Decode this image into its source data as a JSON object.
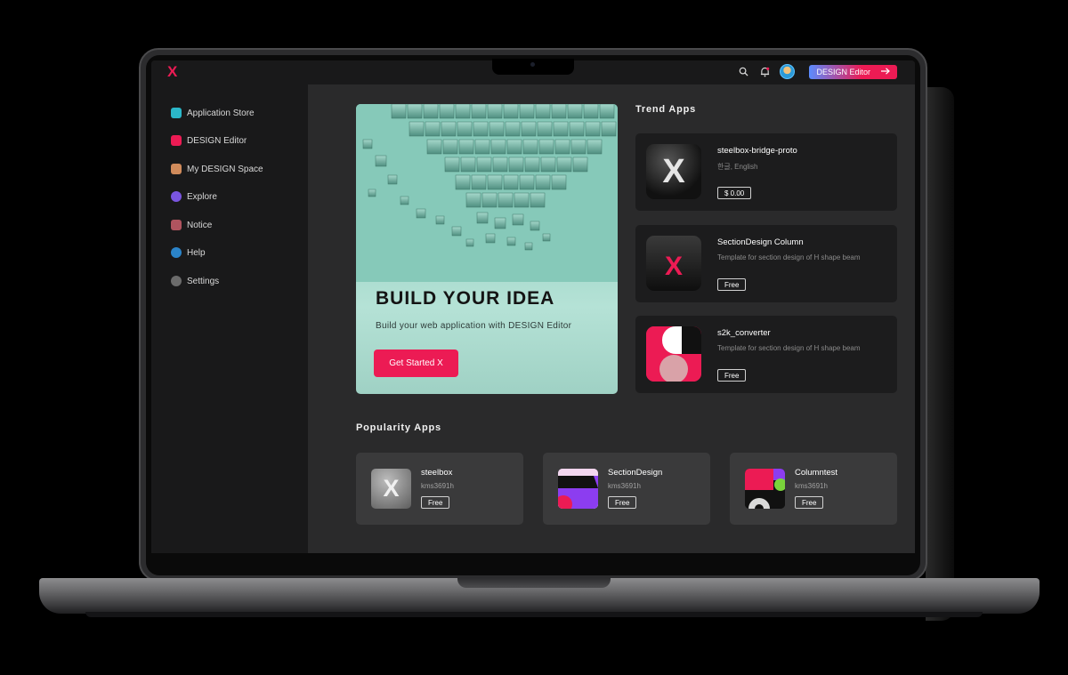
{
  "topbar": {
    "logo": "X",
    "editor_button": "DESIGN Editor",
    "icons": [
      "search-icon",
      "bell-icon",
      "avatar",
      "arrow-right-icon"
    ]
  },
  "sidebar": {
    "items": [
      {
        "label": "Application Store",
        "icon": "store-icon",
        "color": "#2bb7c9"
      },
      {
        "label": "DESIGN Editor",
        "icon": "editor-icon",
        "color": "#ec1b54"
      },
      {
        "label": "My DESIGN Space",
        "icon": "space-icon",
        "color": "#d08b5b"
      },
      {
        "label": "Explore",
        "icon": "compass-icon",
        "color": "#7a55e0"
      },
      {
        "label": "Notice",
        "icon": "notice-icon",
        "color": "#b0545f"
      },
      {
        "label": "Help",
        "icon": "help-icon",
        "color": "#2b84c9"
      },
      {
        "label": "Settings",
        "icon": "gear-icon",
        "color": "#6b6b6b"
      }
    ]
  },
  "hero": {
    "title": "BUILD YOUR IDEA",
    "subtitle": "Build your web application with DESIGN Editor",
    "button": "Get Started X"
  },
  "trend": {
    "title": "Trend Apps",
    "apps": [
      {
        "name": "steelbox-bridge-proto",
        "desc": "한글, English",
        "price": "$ 0.00"
      },
      {
        "name": "SectionDesign Column",
        "desc": "Template for section design of H shape beam",
        "price": "Free"
      },
      {
        "name": "s2k_converter",
        "desc": "Template for section design of H shape beam",
        "price": "Free"
      }
    ]
  },
  "popular": {
    "title": "Popularity Apps",
    "apps": [
      {
        "name": "steelbox",
        "author": "kms3691h",
        "price": "Free"
      },
      {
        "name": "SectionDesign",
        "author": "kms3691h",
        "price": "Free"
      },
      {
        "name": "Columntest",
        "author": "kms3691h",
        "price": "Free"
      }
    ]
  },
  "colors": {
    "accent": "#ec1b54",
    "sidebar": "#19191a",
    "main": "#2a2a2b"
  }
}
